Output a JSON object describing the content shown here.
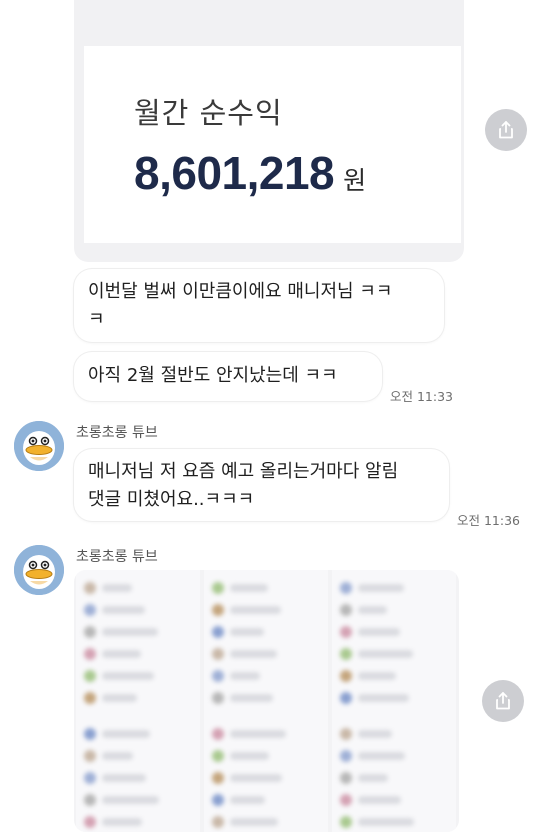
{
  "earnings": {
    "label": "월간 순수익",
    "amount": "8,601,218",
    "unit": "원"
  },
  "messages": [
    {
      "text_line1": "이번달 벌써 이만큼이에요 매니저님 ㅋㅋ",
      "text_line2": "ㅋ"
    },
    {
      "text": "아직 2월 절반도 안지났는데 ㅋㅋ",
      "time": "오전 11:33"
    },
    {
      "sender": "초롱초롱 튜브",
      "text_line1": "매니저님 저 요즘 예고 올리는거마다 알림",
      "text_line2": "댓글 미쳤어요..ㅋㅋㅋ",
      "time": "오전 11:36"
    },
    {
      "sender": "초롱초롱 튜브"
    }
  ],
  "icons": {
    "share": "share-icon",
    "avatar": "duck-avatar-icon"
  },
  "colors": {
    "amount": "#1e2a4a",
    "share_bg": "#cdced2",
    "avatar_bg": "#8fb3d9"
  }
}
